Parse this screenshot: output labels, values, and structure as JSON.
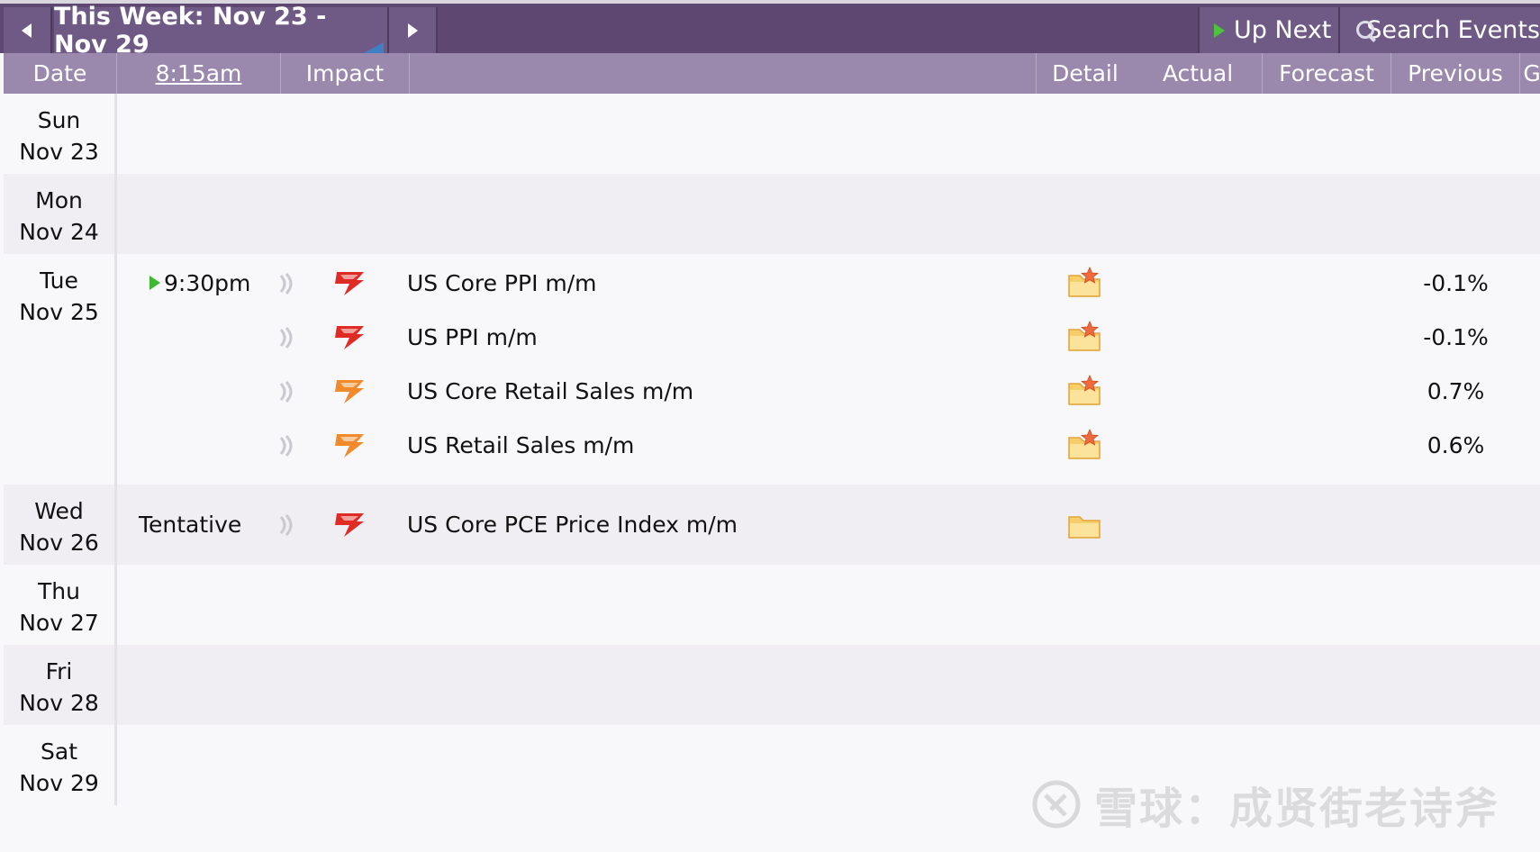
{
  "topbar": {
    "prev_icon": "triangle-left-icon",
    "week_title": "This Week: Nov 23 - Nov 29",
    "next_icon": "triangle-right-icon",
    "up_next_label": "Up Next",
    "search_label": "Search Events"
  },
  "columns": {
    "date": "Date",
    "time": "8:15am",
    "impact": "Impact",
    "detail": "Detail",
    "actual": "Actual",
    "forecast": "Forecast",
    "previous": "Previous",
    "extra": "G"
  },
  "days": [
    {
      "weekday": "Sun",
      "date": "Nov 23",
      "events": []
    },
    {
      "weekday": "Mon",
      "date": "Nov 24",
      "events": []
    },
    {
      "weekday": "Tue",
      "date": "Nov 25",
      "events": [
        {
          "time": "9:30pm",
          "upnext": true,
          "impact": "high",
          "title": "US Core PPI m/m",
          "actual": "",
          "forecast": "",
          "previous": "-0.1%",
          "detail_icon": "folder-star-icon"
        },
        {
          "time": "",
          "upnext": false,
          "impact": "high",
          "title": "US PPI m/m",
          "actual": "",
          "forecast": "",
          "previous": "-0.1%",
          "detail_icon": "folder-star-icon"
        },
        {
          "time": "",
          "upnext": false,
          "impact": "medium",
          "title": "US Core Retail Sales m/m",
          "actual": "",
          "forecast": "",
          "previous": "0.7%",
          "detail_icon": "folder-star-icon"
        },
        {
          "time": "",
          "upnext": false,
          "impact": "medium",
          "title": "US Retail Sales m/m",
          "actual": "",
          "forecast": "",
          "previous": "0.6%",
          "detail_icon": "folder-star-icon"
        }
      ]
    },
    {
      "weekday": "Wed",
      "date": "Nov 26",
      "events": [
        {
          "time": "Tentative",
          "upnext": false,
          "impact": "high",
          "title": "US Core PCE Price Index m/m",
          "actual": "",
          "forecast": "",
          "previous": "",
          "detail_icon": "folder-icon"
        }
      ]
    },
    {
      "weekday": "Thu",
      "date": "Nov 27",
      "events": []
    },
    {
      "weekday": "Fri",
      "date": "Nov 28",
      "events": []
    },
    {
      "weekday": "Sat",
      "date": "Nov 29",
      "events": []
    }
  ],
  "colors": {
    "topbar": "#5e4872",
    "header": "#9b88ad",
    "impact_high": "#e02a24",
    "impact_medium": "#f08a2a",
    "upnext_green": "#3cb930"
  },
  "watermark": "雪球：成贤街老诗斧"
}
